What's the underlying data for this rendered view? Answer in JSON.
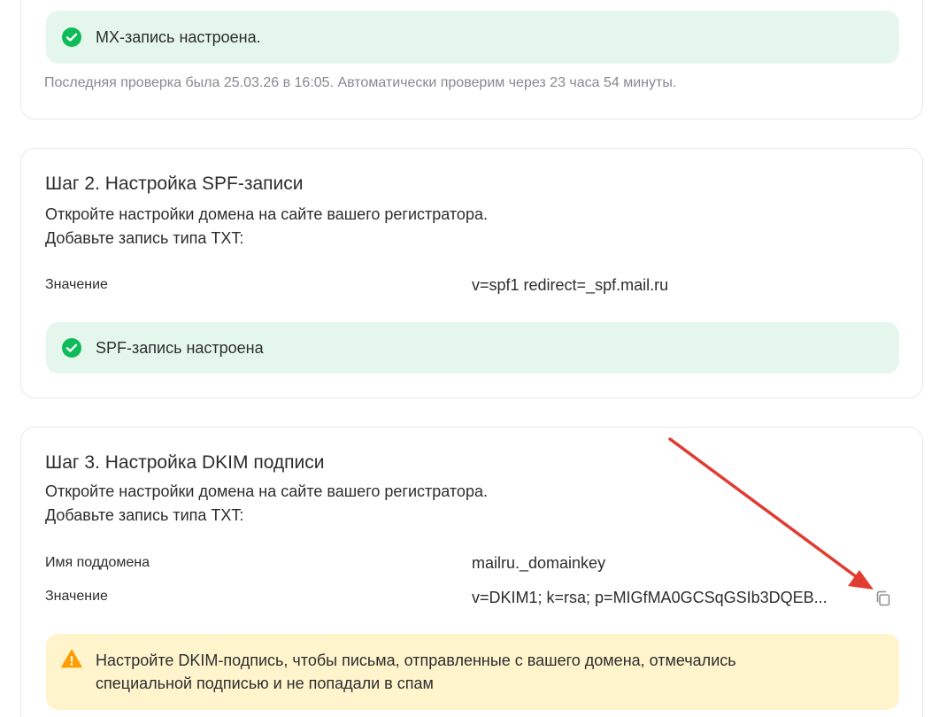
{
  "mx": {
    "status_text": "MX-запись настроена.",
    "last_check": "Последняя проверка была 25.03.26 в 16:05. Автоматически проверим через 23 часа 54 минуты."
  },
  "spf": {
    "title": "Шаг 2. Настройка SPF-записи",
    "desc_line1": "Откройте настройки домена на сайте вашего регистратора.",
    "desc_line2": "Добавьте запись типа TXT:",
    "value_label": "Значение",
    "value": "v=spf1 redirect=_spf.mail.ru",
    "status_text": "SPF-запись настроена"
  },
  "dkim": {
    "title": "Шаг 3. Настройка DKIM подписи",
    "desc_line1": "Откройте настройки домена на сайте вашего регистратора.",
    "desc_line2": "Добавьте запись типа TXT:",
    "subdomain_label": "Имя поддомена",
    "subdomain_value": "mailru._domainkey",
    "value_label": "Значение",
    "value": "v=DKIM1; k=rsa; p=MIGfMA0GCSqGSIb3DQEB...",
    "warning_line1": "Настройте DKIM-подпись, чтобы письма, отправленные с вашего домена, отмечались",
    "warning_line2": "специальной подписью и не попадали в спам"
  },
  "icons": {
    "success": "check-circle-icon",
    "warning": "warning-triangle-icon",
    "copy": "copy-icon",
    "annotation": "red-arrow"
  },
  "colors": {
    "success_bg": "#e5f7ec",
    "success_icon": "#0dbb58",
    "warning_bg": "#fff4cc",
    "warning_icon": "#ff9e00",
    "annotation_arrow": "#e03c31"
  }
}
